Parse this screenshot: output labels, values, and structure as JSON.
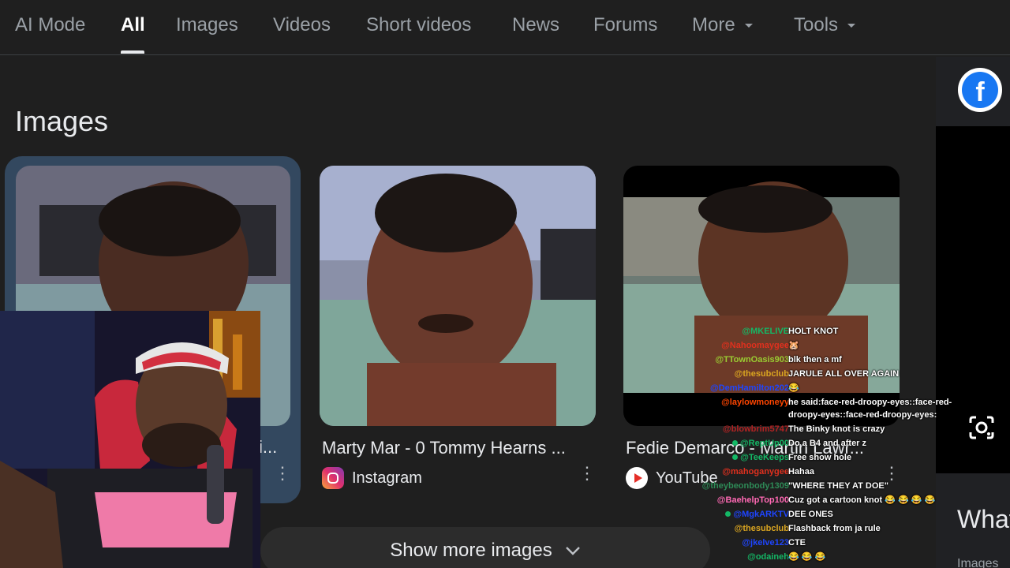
{
  "nav": {
    "tabs": [
      {
        "label": "AI Mode"
      },
      {
        "label": "All"
      },
      {
        "label": "Images"
      },
      {
        "label": "Videos"
      },
      {
        "label": "Short videos"
      },
      {
        "label": "News"
      },
      {
        "label": "Forums"
      },
      {
        "label": "More"
      },
      {
        "label": "Tools"
      }
    ]
  },
  "images_section": {
    "title": "Images",
    "cards": [
      {
        "title": "i...",
        "source": ""
      },
      {
        "title": "Marty Mar - 0 Tommy Hearns ...",
        "source": "Instagram",
        "source_icon": "instagram-icon"
      },
      {
        "title": "Fedie Demarco - Martin Lawr...",
        "source": "YouTube",
        "source_icon": "youtube-icon"
      }
    ],
    "show_more": "Show more images"
  },
  "right_panel": {
    "heading": "What",
    "sub": "Images"
  },
  "chat": [
    {
      "user": "@MKELIVE",
      "color": "#14b866",
      "text": "HOLT KNOT"
    },
    {
      "user": "@Nahoomaygee",
      "color": "#e0301e",
      "text": "🐹"
    },
    {
      "user": "@TTownOasis903",
      "color": "#9acd32",
      "text": "blk then a mf"
    },
    {
      "user": "@thesubclub",
      "color": "#daa520",
      "text": "JARULE ALL OVER AGAIN"
    },
    {
      "user": "@DemHamilton202",
      "color": "#1e45ff",
      "text": "😂"
    },
    {
      "user": "@laylowmoneyy",
      "color": "#ff4500",
      "text": "he said:face-red-droopy-eyes::face-red-droopy-eyes::face-red-droopy-eyes:"
    },
    {
      "user": "@blowbrim5747",
      "color": "#b22222",
      "text": "The Binky knot is crazy"
    },
    {
      "user": "@ReptUp00",
      "color": "#14b866",
      "text": "Do a B4 and after z",
      "badge": true
    },
    {
      "user": "@TeeKeeps",
      "color": "#14b866",
      "text": "Free show hole",
      "badge": true
    },
    {
      "user": "@mahoganygee",
      "color": "#e0301e",
      "text": "Hahaa"
    },
    {
      "user": "@theybeonbody1309",
      "color": "#2e8b57",
      "text": "\"WHERE THEY AT DOE\""
    },
    {
      "user": "@BaehelpTop100",
      "color": "#ff69b4",
      "text": "Cuz got a cartoon knot 😂 😂 😂 😂"
    },
    {
      "user": "@MgkARKTV",
      "color": "#1e45ff",
      "text": "DEE ONES",
      "badge": true
    },
    {
      "user": "@thesubclub",
      "color": "#daa520",
      "text": "Flashback from ja rule"
    },
    {
      "user": "@jkelve123",
      "color": "#1e45ff",
      "text": "CTE"
    },
    {
      "user": "@odaineh",
      "color": "#14b866",
      "text": "😂 😂 😂"
    }
  ]
}
